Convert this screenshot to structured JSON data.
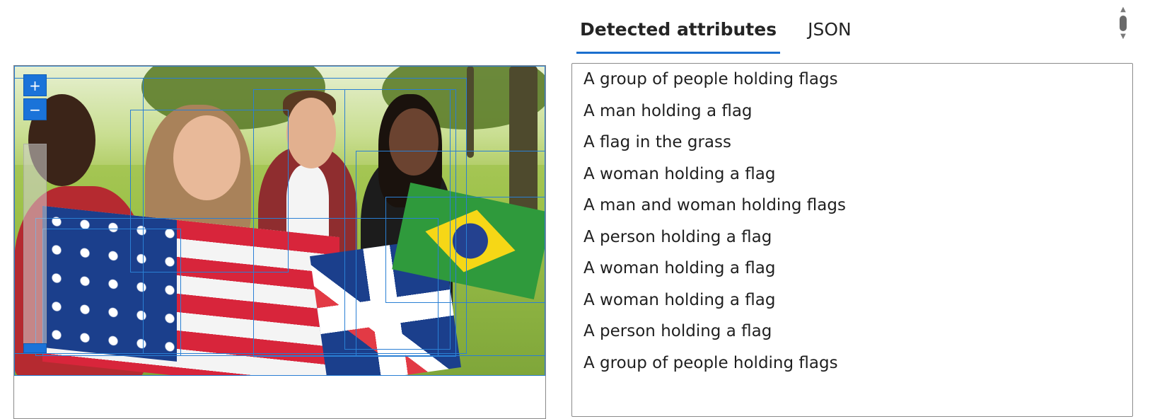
{
  "tabs": [
    {
      "label": "Detected attributes",
      "active": true
    },
    {
      "label": "JSON",
      "active": false
    }
  ],
  "viewer": {
    "zoom_in_label": "+",
    "zoom_out_label": "−"
  },
  "results": [
    "A group of people holding flags",
    "A man holding a flag",
    "A flag in the grass",
    "A woman holding a flag",
    "A man and woman holding flags",
    "A person holding a flag",
    "A woman holding a flag",
    "A woman holding a flag",
    "A person holding a flag",
    "A group of people holding flags"
  ],
  "colors": {
    "accent": "#1a73d9",
    "bbox": "#2a7fd4",
    "tab_underline": "#1a6fce"
  },
  "icons": {
    "scroll_up": "chevron-up-icon",
    "scroll_down": "chevron-down-icon"
  }
}
